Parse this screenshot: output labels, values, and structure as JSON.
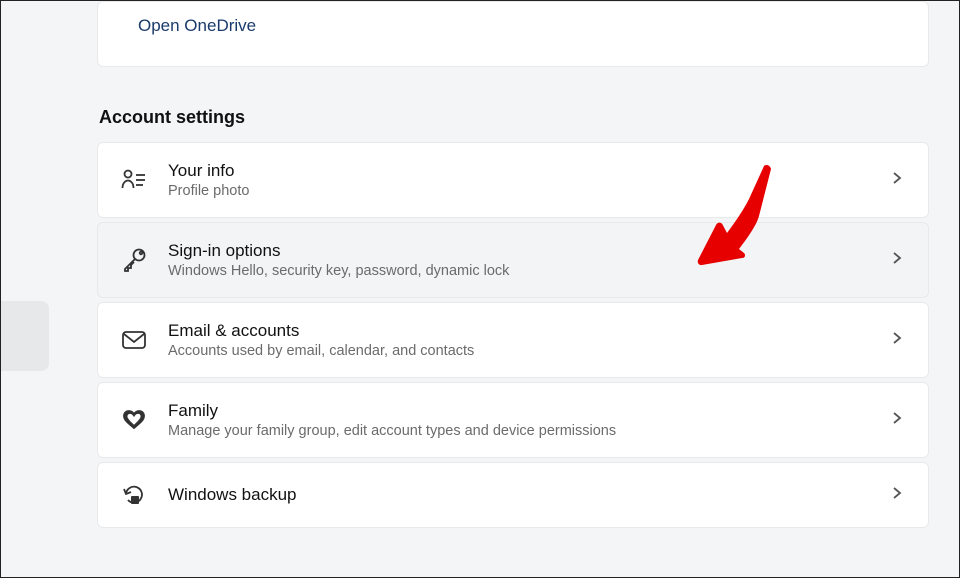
{
  "onedrive": {
    "link": "Open OneDrive"
  },
  "section_heading": "Account settings",
  "items": [
    {
      "icon": "person-lines-icon",
      "title": "Your info",
      "desc": "Profile photo",
      "highlighted": false
    },
    {
      "icon": "key-icon",
      "title": "Sign-in options",
      "desc": "Windows Hello, security key, password, dynamic lock",
      "highlighted": true
    },
    {
      "icon": "mail-icon",
      "title": "Email & accounts",
      "desc": "Accounts used by email, calendar, and contacts",
      "highlighted": false
    },
    {
      "icon": "hearts-icon",
      "title": "Family",
      "desc": "Manage your family group, edit account types and device permissions",
      "highlighted": false
    },
    {
      "icon": "backup-icon",
      "title": "Windows backup",
      "desc": "",
      "highlighted": false
    }
  ],
  "annotation": {
    "type": "red-arrow",
    "color": "#e70000"
  }
}
